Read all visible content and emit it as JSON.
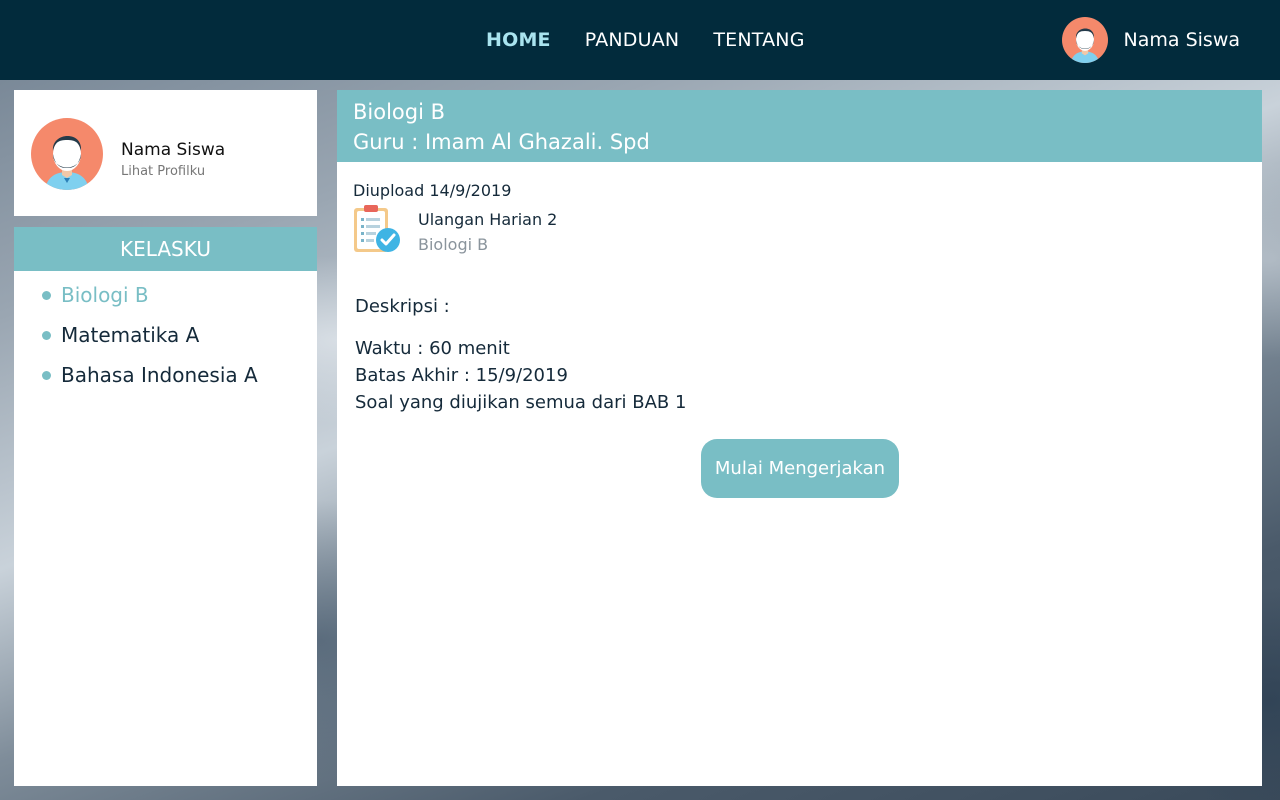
{
  "nav": {
    "items": [
      "HOME",
      "PANDUAN",
      "TENTANG"
    ],
    "active": "HOME"
  },
  "user": {
    "name": "Nama Siswa",
    "profile_link": "Lihat Profilku"
  },
  "sidebar": {
    "header": "KELASKU",
    "classes": [
      {
        "label": "Biologi B",
        "active": true
      },
      {
        "label": "Matematika A",
        "active": false
      },
      {
        "label": "Bahasa Indonesia A",
        "active": false
      }
    ]
  },
  "main": {
    "class_title": "Biologi B",
    "teacher": "Guru : Imam Al Ghazali. Spd",
    "upload_date": "Diupload 14/9/2019",
    "task_title": "Ulangan Harian 2",
    "task_class": "Biologi B",
    "description_label": "Deskripsi :",
    "description_lines": [
      "Waktu : 60 menit",
      "Batas Akhir : 15/9/2019",
      "Soal yang diujikan semua dari BAB 1"
    ],
    "start_button": "Mulai Mengerjakan"
  },
  "colors": {
    "navbar": "#022b3c",
    "accent": "#79bec5",
    "nav_active": "#a9e4ef",
    "avatar_bg": "#f5896b"
  },
  "icons": {
    "avatar": "user-avatar-icon",
    "task": "clipboard-check-icon",
    "bullet": "dot-icon"
  }
}
